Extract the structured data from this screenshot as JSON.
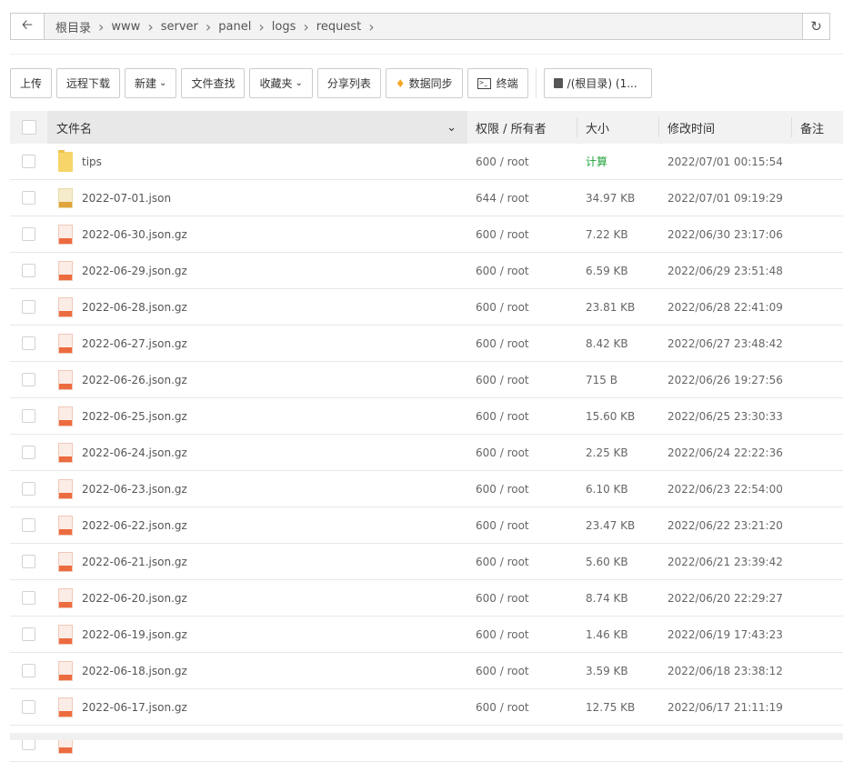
{
  "path": {
    "crumbs": [
      "根目录",
      "www",
      "server",
      "panel",
      "logs",
      "request"
    ]
  },
  "toolbar": {
    "upload": "上传",
    "remote_download": "远程下载",
    "new": "新建",
    "search": "文件查找",
    "favorites": "收藏夹",
    "share_list": "分享列表",
    "sync": "数据同步",
    "terminal": "终端",
    "disk": "/(根目录) (1..."
  },
  "headers": {
    "name": "文件名",
    "perm": "权限 / 所有者",
    "size": "大小",
    "mtime": "修改时间",
    "note": "备注"
  },
  "colors": {
    "accent": "#20a53a",
    "gz": "#ec6b3f",
    "json": "#e0a43a"
  },
  "rows": [
    {
      "type": "folder",
      "name": "tips",
      "perm": "600 / root",
      "size": "计算",
      "mtime": "2022/07/01 00:15:54"
    },
    {
      "type": "json",
      "name": "2022-07-01.json",
      "perm": "644 / root",
      "size": "34.97 KB",
      "mtime": "2022/07/01 09:19:29"
    },
    {
      "type": "gz",
      "name": "2022-06-30.json.gz",
      "perm": "600 / root",
      "size": "7.22 KB",
      "mtime": "2022/06/30 23:17:06"
    },
    {
      "type": "gz",
      "name": "2022-06-29.json.gz",
      "perm": "600 / root",
      "size": "6.59 KB",
      "mtime": "2022/06/29 23:51:48"
    },
    {
      "type": "gz",
      "name": "2022-06-28.json.gz",
      "perm": "600 / root",
      "size": "23.81 KB",
      "mtime": "2022/06/28 22:41:09"
    },
    {
      "type": "gz",
      "name": "2022-06-27.json.gz",
      "perm": "600 / root",
      "size": "8.42 KB",
      "mtime": "2022/06/27 23:48:42"
    },
    {
      "type": "gz",
      "name": "2022-06-26.json.gz",
      "perm": "600 / root",
      "size": "715 B",
      "mtime": "2022/06/26 19:27:56"
    },
    {
      "type": "gz",
      "name": "2022-06-25.json.gz",
      "perm": "600 / root",
      "size": "15.60 KB",
      "mtime": "2022/06/25 23:30:33"
    },
    {
      "type": "gz",
      "name": "2022-06-24.json.gz",
      "perm": "600 / root",
      "size": "2.25 KB",
      "mtime": "2022/06/24 22:22:36"
    },
    {
      "type": "gz",
      "name": "2022-06-23.json.gz",
      "perm": "600 / root",
      "size": "6.10 KB",
      "mtime": "2022/06/23 22:54:00"
    },
    {
      "type": "gz",
      "name": "2022-06-22.json.gz",
      "perm": "600 / root",
      "size": "23.47 KB",
      "mtime": "2022/06/22 23:21:20"
    },
    {
      "type": "gz",
      "name": "2022-06-21.json.gz",
      "perm": "600 / root",
      "size": "5.60 KB",
      "mtime": "2022/06/21 23:39:42"
    },
    {
      "type": "gz",
      "name": "2022-06-20.json.gz",
      "perm": "600 / root",
      "size": "8.74 KB",
      "mtime": "2022/06/20 22:29:27"
    },
    {
      "type": "gz",
      "name": "2022-06-19.json.gz",
      "perm": "600 / root",
      "size": "1.46 KB",
      "mtime": "2022/06/19 17:43:23"
    },
    {
      "type": "gz",
      "name": "2022-06-18.json.gz",
      "perm": "600 / root",
      "size": "3.59 KB",
      "mtime": "2022/06/18 23:38:12"
    },
    {
      "type": "gz",
      "name": "2022-06-17.json.gz",
      "perm": "600 / root",
      "size": "12.75 KB",
      "mtime": "2022/06/17 21:11:19"
    }
  ]
}
